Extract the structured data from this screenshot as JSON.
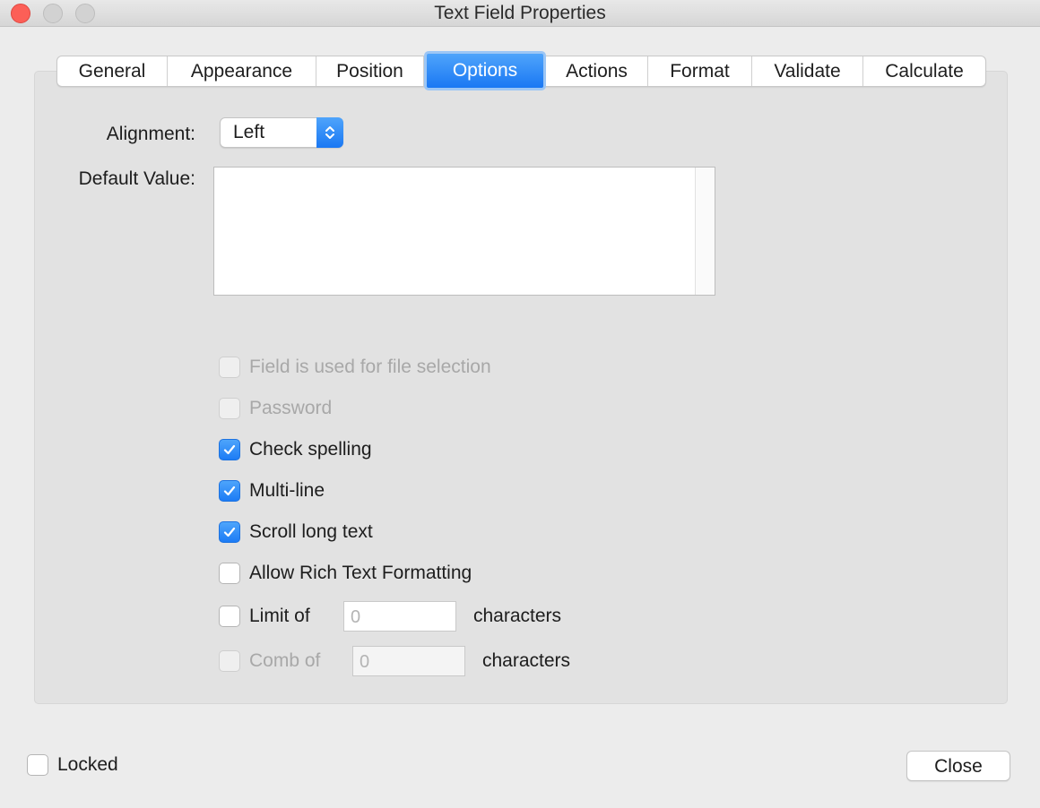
{
  "window": {
    "title": "Text Field Properties"
  },
  "tabs": [
    {
      "label": "General"
    },
    {
      "label": "Appearance"
    },
    {
      "label": "Position"
    },
    {
      "label": "Options",
      "active": true
    },
    {
      "label": "Actions"
    },
    {
      "label": "Format"
    },
    {
      "label": "Validate"
    },
    {
      "label": "Calculate"
    }
  ],
  "options": {
    "alignment_label": "Alignment:",
    "alignment_value": "Left",
    "default_value_label": "Default Value:",
    "default_value": "",
    "checkboxes": [
      {
        "label": "Field is used for file selection",
        "checked": false,
        "disabled": true
      },
      {
        "label": "Password",
        "checked": false,
        "disabled": true
      },
      {
        "label": "Check spelling",
        "checked": true,
        "disabled": false
      },
      {
        "label": "Multi-line",
        "checked": true,
        "disabled": false
      },
      {
        "label": "Scroll long text",
        "checked": true,
        "disabled": false
      },
      {
        "label": "Allow Rich Text Formatting",
        "checked": false,
        "disabled": false
      }
    ],
    "limit": {
      "label": "Limit of",
      "checked": false,
      "disabled": false,
      "value": "0",
      "suffix": "characters"
    },
    "comb": {
      "label": "Comb of",
      "checked": false,
      "disabled": true,
      "value": "0",
      "suffix": "characters"
    }
  },
  "footer": {
    "locked_label": "Locked",
    "locked_checked": false,
    "close_label": "Close"
  },
  "colors": {
    "accent": "#1a78f3",
    "close_dot": "#fc5f57"
  }
}
